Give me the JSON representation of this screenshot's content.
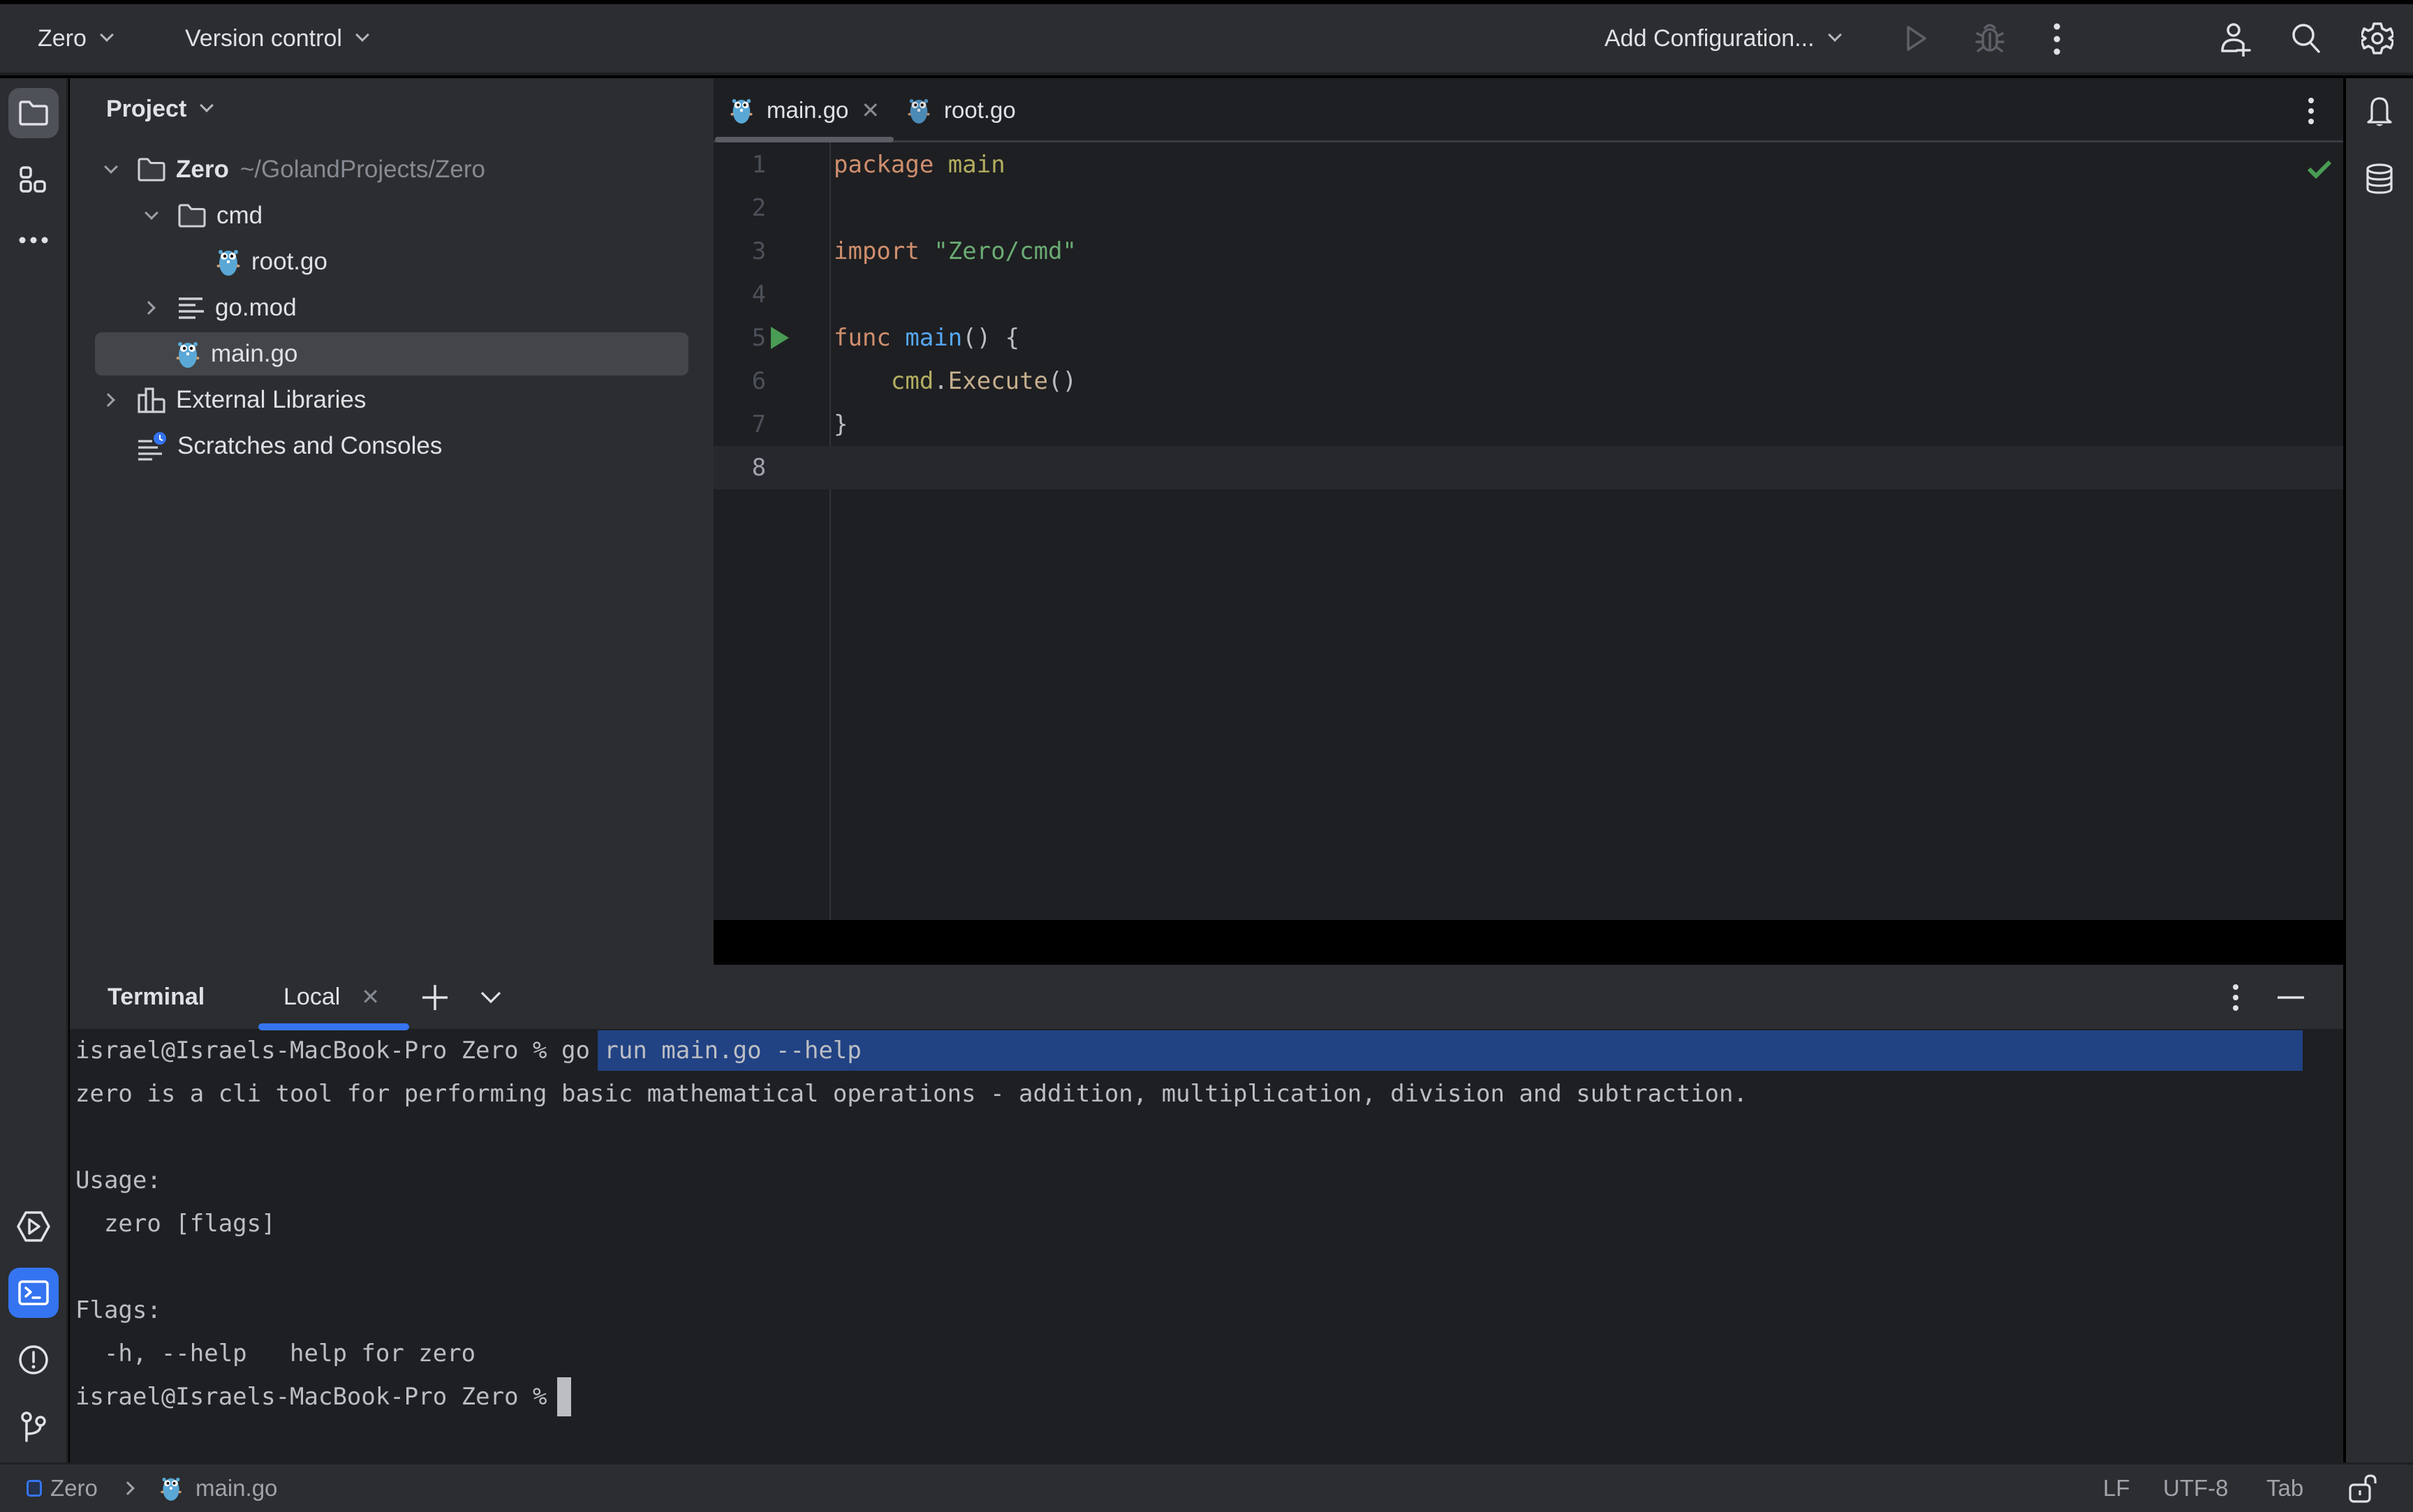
{
  "topbar": {
    "project_name": "Zero",
    "vcs_label": "Version control",
    "run_config_label": "Add Configuration...",
    "icons": [
      "play-icon",
      "debug-bug-icon",
      "more-vertical-icon",
      "add-user-icon",
      "search-icon",
      "gear-icon"
    ]
  },
  "left_strip": {
    "top_icons": [
      "folder-icon",
      "structure-icon",
      "more-horizontal-icon"
    ],
    "bottom_icons": [
      "run-services-icon",
      "terminal-icon",
      "problems-icon",
      "git-branch-icon"
    ]
  },
  "project_panel": {
    "title": "Project",
    "tree": [
      {
        "label": "Zero",
        "sublabel": "~/GolandProjects/Zero",
        "icon": "folder-icon",
        "expanded": true,
        "depth": 0,
        "bold": true
      },
      {
        "label": "cmd",
        "icon": "folder-icon",
        "expanded": true,
        "depth": 1
      },
      {
        "label": "root.go",
        "icon": "gopher-icon",
        "depth": 2
      },
      {
        "label": "go.mod",
        "icon": "text-file-icon",
        "expanded": false,
        "depth": 1
      },
      {
        "label": "main.go",
        "icon": "gopher-icon",
        "depth": 1,
        "selected": true
      },
      {
        "label": "External Libraries",
        "icon": "library-icon",
        "expanded": false,
        "depth": 0
      },
      {
        "label": "Scratches and Consoles",
        "icon": "scratches-icon",
        "depth": 0
      }
    ]
  },
  "editor": {
    "tabs": [
      {
        "label": "main.go",
        "active": true,
        "closable": true
      },
      {
        "label": "root.go",
        "active": false
      }
    ],
    "line_numbers": [
      "1",
      "2",
      "3",
      "4",
      "5",
      "6",
      "7",
      "8"
    ],
    "code": {
      "l1_kw": "package",
      "l1_name": "main",
      "l3_kw": "import",
      "l3_str": "\"Zero/cmd\"",
      "l5_kw": "func",
      "l5_fn": "main",
      "l5_rest": "() {",
      "l6_pkg": "cmd",
      "l6_dot": ".",
      "l6_method": "Execute",
      "l6_rest": "()",
      "l7": "}"
    },
    "current_line": 8,
    "inspection_status": "ok"
  },
  "right_strip": {
    "icons": [
      "notifications-bell-icon",
      "database-icon"
    ]
  },
  "terminal": {
    "title": "Terminal",
    "tab_label": "Local",
    "lines": {
      "prompt1": "israel@Israels-MacBook-Pro Zero % ",
      "command": "go run main.go --help",
      "desc": "zero is a cli tool for performing basic mathematical operations - addition, multiplication, division and subtraction.",
      "usage_header": "Usage:",
      "usage_cmd": "  zero [flags]",
      "flags_header": "Flags:",
      "flag_help": "  -h, --help   help for zero",
      "prompt2": "israel@Israels-MacBook-Pro Zero %"
    }
  },
  "statusbar": {
    "breadcrumb_project": "Zero",
    "breadcrumb_file": "main.go",
    "line_separator": "LF",
    "encoding": "UTF-8",
    "indent": "Tab"
  },
  "colors": {
    "accent": "#3574f0",
    "selection": "#214283",
    "keyword": "#cf8e6d",
    "string": "#6aab73",
    "function": "#56a8f5",
    "run_green": "#499c54"
  }
}
